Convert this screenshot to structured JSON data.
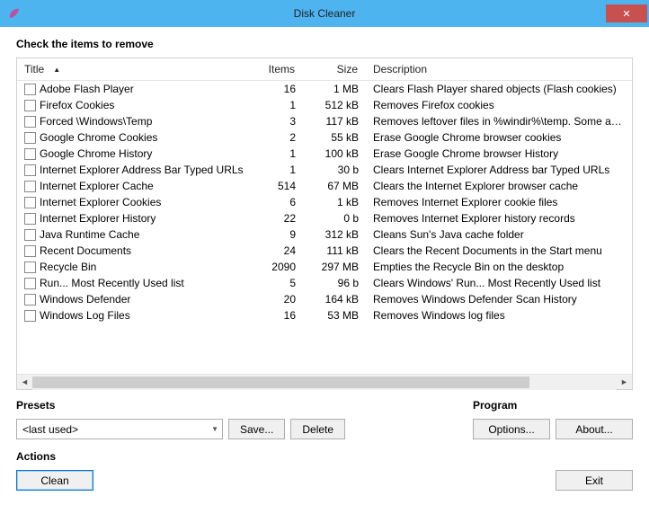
{
  "window": {
    "title": "Disk Cleaner"
  },
  "main": {
    "heading": "Check the items to remove"
  },
  "columns": {
    "title": "Title",
    "items": "Items",
    "size": "Size",
    "desc": "Description"
  },
  "rows": [
    {
      "title": "Adobe Flash Player",
      "items": "16",
      "size": "1 MB",
      "desc": "Clears Flash Player shared objects (Flash cookies)"
    },
    {
      "title": "Firefox Cookies",
      "items": "1",
      "size": "512 kB",
      "desc": "Removes Firefox cookies"
    },
    {
      "title": "Forced \\Windows\\Temp",
      "items": "3",
      "size": "117 kB",
      "desc": "Removes leftover files in %windir%\\temp. Some appli"
    },
    {
      "title": "Google Chrome Cookies",
      "items": "2",
      "size": "55 kB",
      "desc": "Erase Google Chrome browser cookies"
    },
    {
      "title": "Google Chrome History",
      "items": "1",
      "size": "100 kB",
      "desc": "Erase Google Chrome browser History"
    },
    {
      "title": "Internet Explorer Address Bar Typed URLs",
      "items": "1",
      "size": "30 b",
      "desc": "Clears Internet Explorer Address bar Typed URLs"
    },
    {
      "title": "Internet Explorer Cache",
      "items": "514",
      "size": "67 MB",
      "desc": "Clears the Internet Explorer browser cache"
    },
    {
      "title": "Internet Explorer Cookies",
      "items": "6",
      "size": "1 kB",
      "desc": "Removes Internet Explorer cookie files"
    },
    {
      "title": "Internet Explorer History",
      "items": "22",
      "size": "0 b",
      "desc": "Removes Internet Explorer history records"
    },
    {
      "title": "Java Runtime Cache",
      "items": "9",
      "size": "312 kB",
      "desc": "Cleans Sun's Java cache folder"
    },
    {
      "title": "Recent Documents",
      "items": "24",
      "size": "111 kB",
      "desc": "Clears the Recent Documents in the Start menu"
    },
    {
      "title": "Recycle Bin",
      "items": "2090",
      "size": "297 MB",
      "desc": "Empties the Recycle Bin on the desktop"
    },
    {
      "title": "Run... Most Recently Used list",
      "items": "5",
      "size": "96 b",
      "desc": "Clears Windows' Run... Most Recently Used list"
    },
    {
      "title": "Windows Defender",
      "items": "20",
      "size": "164 kB",
      "desc": "Removes Windows Defender Scan History"
    },
    {
      "title": "Windows Log Files",
      "items": "16",
      "size": "53 MB",
      "desc": "Removes Windows log files"
    }
  ],
  "presets": {
    "label": "Presets",
    "selected": "<last used>",
    "save": "Save...",
    "delete": "Delete"
  },
  "program": {
    "label": "Program",
    "options": "Options...",
    "about": "About..."
  },
  "actions": {
    "label": "Actions",
    "clean": "Clean",
    "exit": "Exit"
  }
}
